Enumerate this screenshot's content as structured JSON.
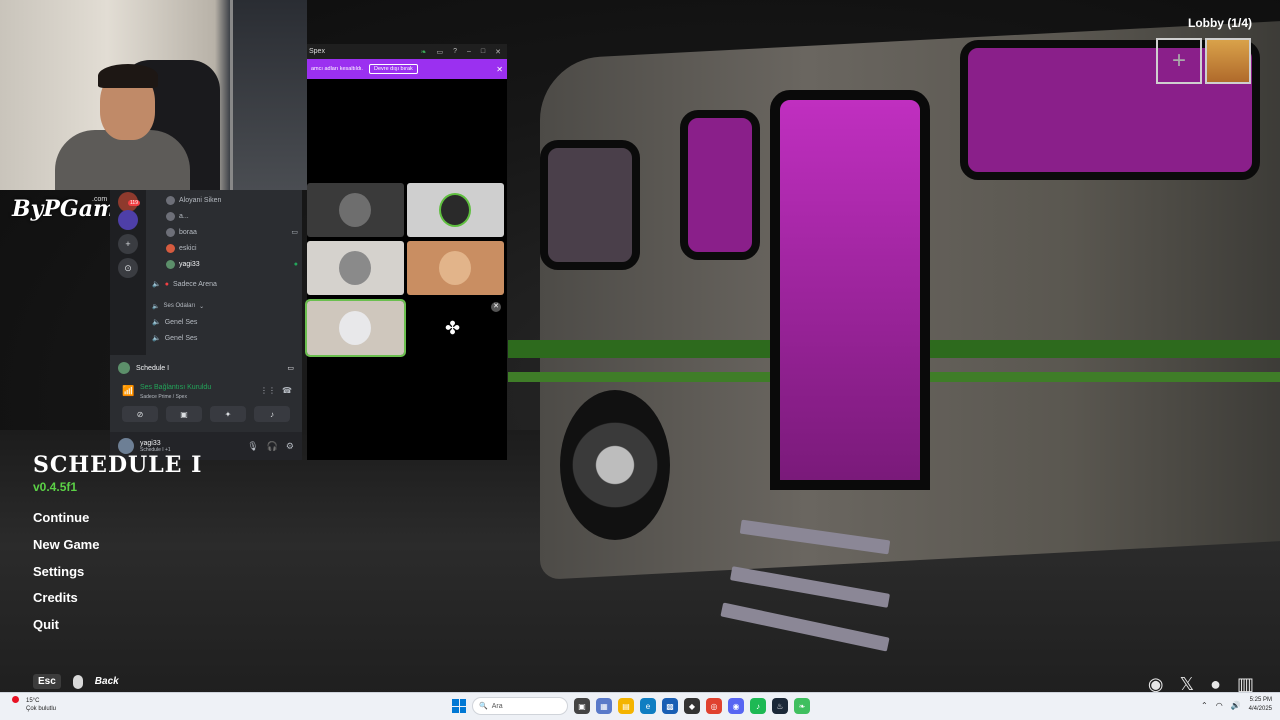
{
  "discord_panel": {
    "badge": "119",
    "members": [
      "Aloyani Siken",
      "a...",
      "boraa",
      "eskici",
      "yagi33"
    ],
    "channel": "Sadece Arena",
    "section": "Ses Odaları",
    "voice_channels": [
      "Genel Ses",
      "Genel Ses"
    ],
    "game_activity": "Schedule I",
    "voice_status": "Ses Bağlantısı Kuruldu",
    "voice_location": "Sadece Prime / Spex",
    "user": {
      "name": "yagi33",
      "status": "Schedule I +1"
    }
  },
  "spex": {
    "title": "Spex",
    "banner_text": "amcı adları kesaltıldı.",
    "banner_button": "Devre dışı bırak"
  },
  "game": {
    "title": "SCHEDULE I",
    "version": "v0.4.5f1",
    "menu": [
      "Continue",
      "New Game",
      "Settings",
      "Credits",
      "Quit"
    ],
    "esc_key": "Esc",
    "back_label": "Back",
    "lobby": "Lobby (1/4)"
  },
  "taskbar": {
    "weather_temp": "15°C",
    "weather_desc": "Çok bulutlu",
    "search_placeholder": "Ara",
    "time": "5:25 PM",
    "date": "4/4/2025"
  }
}
